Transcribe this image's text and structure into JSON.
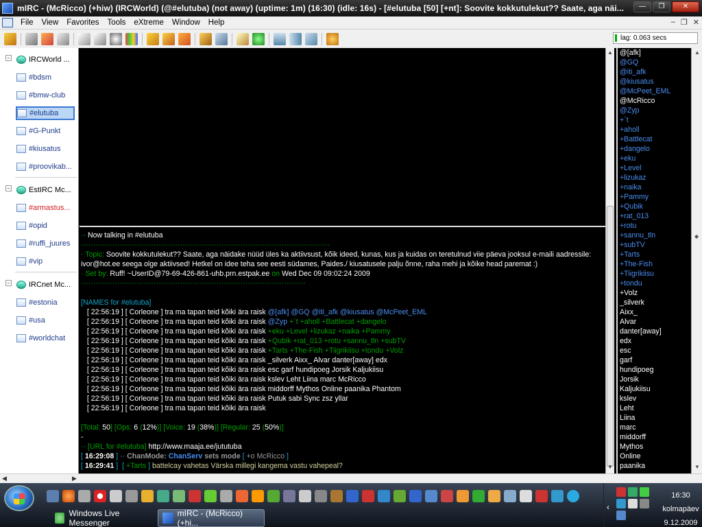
{
  "window": {
    "title": "mIRC - (McRicco) (+hiw) (IRCWorld) (@#elutuba) (not away) (uptime: 1m) (16:30) (idle: 16s) - [#elutuba [50] [+nt]: Soovite kokkutulekut?? Saate, aga näi..."
  },
  "menu": [
    "File",
    "View",
    "Favorites",
    "Tools",
    "eXtreme",
    "Window",
    "Help"
  ],
  "lag": "lag: 0.063 secs",
  "treebar": {
    "items": [
      {
        "label": "IRCWorld ...",
        "kind": "server",
        "state": "plain"
      },
      {
        "label": "#bdsm",
        "kind": "channel",
        "state": "normal"
      },
      {
        "label": "#bmw-club",
        "kind": "channel",
        "state": "normal"
      },
      {
        "label": "#elutuba",
        "kind": "channel",
        "state": "active"
      },
      {
        "label": "#G-Punkt",
        "kind": "channel",
        "state": "normal"
      },
      {
        "label": "#kiusatus",
        "kind": "channel",
        "state": "normal"
      },
      {
        "label": "#proovikab...",
        "kind": "channel",
        "state": "normal"
      },
      {
        "label": "EstIRC Mc...",
        "kind": "server",
        "state": "plain"
      },
      {
        "label": "#armastus...",
        "kind": "channel",
        "state": "alert"
      },
      {
        "label": "#opid",
        "kind": "channel",
        "state": "normal"
      },
      {
        "label": "#ruffi_juures",
        "kind": "channel",
        "state": "normal"
      },
      {
        "label": "#vip",
        "kind": "channel",
        "state": "normal"
      },
      {
        "label": "IRCnet Mc...",
        "kind": "server",
        "state": "plain"
      },
      {
        "label": "#estonia",
        "kind": "channel",
        "state": "normal"
      },
      {
        "label": "#usa",
        "kind": "channel",
        "state": "normal"
      },
      {
        "label": "#worldchat",
        "kind": "channel",
        "state": "normal"
      }
    ]
  },
  "chat": {
    "now_talking": "Now talking in #elutuba",
    "topic_label": "Topic:",
    "topic_text": "Soovite kokkutulekut?? Saate, aga näidake nüüd üles ka aktiivsust, kõik ideed, kunas, kus ja kuidas on teretulnud viie päeva jooksul e-maili aadressile: ivor@hot.ee seega olge aktiivsed! Hetkel on idee teha see eesti südames, Paides./ kiusatusele palju õnne, raha mehi ja kõike head paremat :)",
    "setby_label": "Set by:",
    "setby_user": "Ruff! ~UserID@79-69-426-861-uhb.prn.estpak.ee",
    "setby_on": "on",
    "setby_date": "Wed Dec 09 09:02:24 2009",
    "names_header": "[NAMES for #elutuba]",
    "names_prefix": "[ 22:56:19 ] [ Corleone ] tra ma tapan teid kõiki ära raisk",
    "names_lines": [
      [
        {
          "t": "@[afk]",
          "c": "b"
        },
        {
          "t": "@GQ",
          "c": "b"
        },
        {
          "t": "@iti_afk",
          "c": "b"
        },
        {
          "t": "@kiusatus",
          "c": "b"
        },
        {
          "t": "@McPeet_EML",
          "c": "b"
        }
      ],
      [
        {
          "t": "@Zyp",
          "c": "b"
        },
        {
          "t": "+`t",
          "c": "g"
        },
        {
          "t": "+aholl",
          "c": "g"
        },
        {
          "t": "+Battlecat",
          "c": "g"
        },
        {
          "t": "+dangelo",
          "c": "g"
        }
      ],
      [
        {
          "t": "+eku",
          "c": "g"
        },
        {
          "t": "+Level",
          "c": "g"
        },
        {
          "t": "+lizukaz",
          "c": "g"
        },
        {
          "t": "+naika",
          "c": "g"
        },
        {
          "t": "+Pammy",
          "c": "g"
        }
      ],
      [
        {
          "t": "+Qubik",
          "c": "g"
        },
        {
          "t": "+rat_013",
          "c": "g"
        },
        {
          "t": "+rotu",
          "c": "g"
        },
        {
          "t": "+sannu_tln",
          "c": "g"
        },
        {
          "t": "+subTV",
          "c": "g"
        }
      ],
      [
        {
          "t": "+Tarts",
          "c": "g"
        },
        {
          "t": "+The-Fish",
          "c": "g"
        },
        {
          "t": "+Tiigrikiisu",
          "c": "g"
        },
        {
          "t": "+tondu",
          "c": "g"
        },
        {
          "t": "+Volz",
          "c": "g"
        }
      ],
      [
        {
          "t": "_silverk",
          "c": "w"
        },
        {
          "t": "Aixx_",
          "c": "w"
        },
        {
          "t": "Alvar",
          "c": "w"
        },
        {
          "t": "danter[away]",
          "c": "w"
        },
        {
          "t": "edx",
          "c": "w"
        }
      ],
      [
        {
          "t": "esc",
          "c": "w"
        },
        {
          "t": "garf",
          "c": "w"
        },
        {
          "t": "hundipoeg",
          "c": "w"
        },
        {
          "t": "Jorsik",
          "c": "w"
        },
        {
          "t": "Kaljukiisu",
          "c": "w"
        }
      ],
      [
        {
          "t": "kslev",
          "c": "w"
        },
        {
          "t": "Leht",
          "c": "w"
        },
        {
          "t": "Liina",
          "c": "w"
        },
        {
          "t": "marc",
          "c": "w"
        },
        {
          "t": "McRicco",
          "c": "w"
        }
      ],
      [
        {
          "t": "middorff",
          "c": "w"
        },
        {
          "t": "Mythos",
          "c": "w"
        },
        {
          "t": "Online",
          "c": "w"
        },
        {
          "t": "paanika",
          "c": "w"
        },
        {
          "t": "Phantom",
          "c": "w"
        }
      ],
      [
        {
          "t": "Putuk",
          "c": "w"
        },
        {
          "t": "sabi",
          "c": "w"
        },
        {
          "t": "Sync",
          "c": "w"
        },
        {
          "t": "zsz",
          "c": "w"
        },
        {
          "t": "yllar",
          "c": "w"
        }
      ],
      []
    ],
    "total": {
      "total_label": "Total:",
      "total": "50",
      "ops_label": "Ops:",
      "ops": "6",
      "ops_pct": "12%",
      "voice_label": "Voice:",
      "voice": "19",
      "voice_pct": "38%",
      "reg_label": "Regular:",
      "reg": "25",
      "reg_pct": "50%"
    },
    "url_label": "[URL for #elutuba]",
    "url": "http://www.maaja.ee/jututuba",
    "mode_time": "16:29:08",
    "mode_label": "ChanMode:",
    "mode_by": "ChanServ",
    "mode_text": "sets mode",
    "mode_value": "+o McRicco",
    "msg_time": "16:29:41",
    "msg_nick": "+Tarts",
    "msg_text": "battelcay vahetas Värska millegi kangema vastu vahepeal?"
  },
  "nicklist": [
    {
      "n": "@[afk]",
      "k": "opwhite"
    },
    {
      "n": "@GQ",
      "k": "ops"
    },
    {
      "n": "@iti_afk",
      "k": "ops"
    },
    {
      "n": "@kiusatus",
      "k": "ops"
    },
    {
      "n": "@McPeet_EML",
      "k": "ops"
    },
    {
      "n": "@McRicco",
      "k": "opwhite"
    },
    {
      "n": "@Zyp",
      "k": "ops"
    },
    {
      "n": "+`t",
      "k": "voice"
    },
    {
      "n": "+aholl",
      "k": "voice"
    },
    {
      "n": "+Battlecat",
      "k": "voice"
    },
    {
      "n": "+dangelo",
      "k": "voice"
    },
    {
      "n": "+eku",
      "k": "voice"
    },
    {
      "n": "+Level",
      "k": "voice"
    },
    {
      "n": "+lizukaz",
      "k": "voice"
    },
    {
      "n": "+naika",
      "k": "voice"
    },
    {
      "n": "+Pammy",
      "k": "voice"
    },
    {
      "n": "+Qubik",
      "k": "voice"
    },
    {
      "n": "+rat_013",
      "k": "voice"
    },
    {
      "n": "+rotu",
      "k": "voice"
    },
    {
      "n": "+sannu_tln",
      "k": "voice"
    },
    {
      "n": "+subTV",
      "k": "voice"
    },
    {
      "n": "+Tarts",
      "k": "voice"
    },
    {
      "n": "+The-Fish",
      "k": "voice"
    },
    {
      "n": "+Tiigrikiisu",
      "k": "voice"
    },
    {
      "n": "+tondu",
      "k": "voice"
    },
    {
      "n": "+Volz",
      "k": "reg"
    },
    {
      "n": "_silverk",
      "k": "reg"
    },
    {
      "n": "Aixx_",
      "k": "reg"
    },
    {
      "n": "Alvar",
      "k": "reg"
    },
    {
      "n": "danter[away]",
      "k": "reg"
    },
    {
      "n": "edx",
      "k": "reg"
    },
    {
      "n": "esc",
      "k": "reg"
    },
    {
      "n": "garf",
      "k": "reg"
    },
    {
      "n": "hundipoeg",
      "k": "reg"
    },
    {
      "n": "Jorsik",
      "k": "reg"
    },
    {
      "n": "Kaljukiisu",
      "k": "reg"
    },
    {
      "n": "kslev",
      "k": "reg"
    },
    {
      "n": "Leht",
      "k": "reg"
    },
    {
      "n": "Liina",
      "k": "reg"
    },
    {
      "n": "marc",
      "k": "reg"
    },
    {
      "n": "middorff",
      "k": "reg"
    },
    {
      "n": "Mythos",
      "k": "reg"
    },
    {
      "n": "Online",
      "k": "reg"
    },
    {
      "n": "paanika",
      "k": "reg"
    }
  ],
  "taskbar": {
    "tasks": [
      {
        "label": "Windows Live Messenger",
        "active": false
      },
      {
        "label": "mIRC - (McRicco) (+hi...",
        "active": true
      }
    ],
    "time": "16:30",
    "day": "kolmapäev",
    "date": "9.12.2009"
  },
  "colors": {
    "accent": "#3a78d2",
    "voice": "#00a000",
    "op": "#4a8ef0",
    "channel": "#12a5c8"
  }
}
